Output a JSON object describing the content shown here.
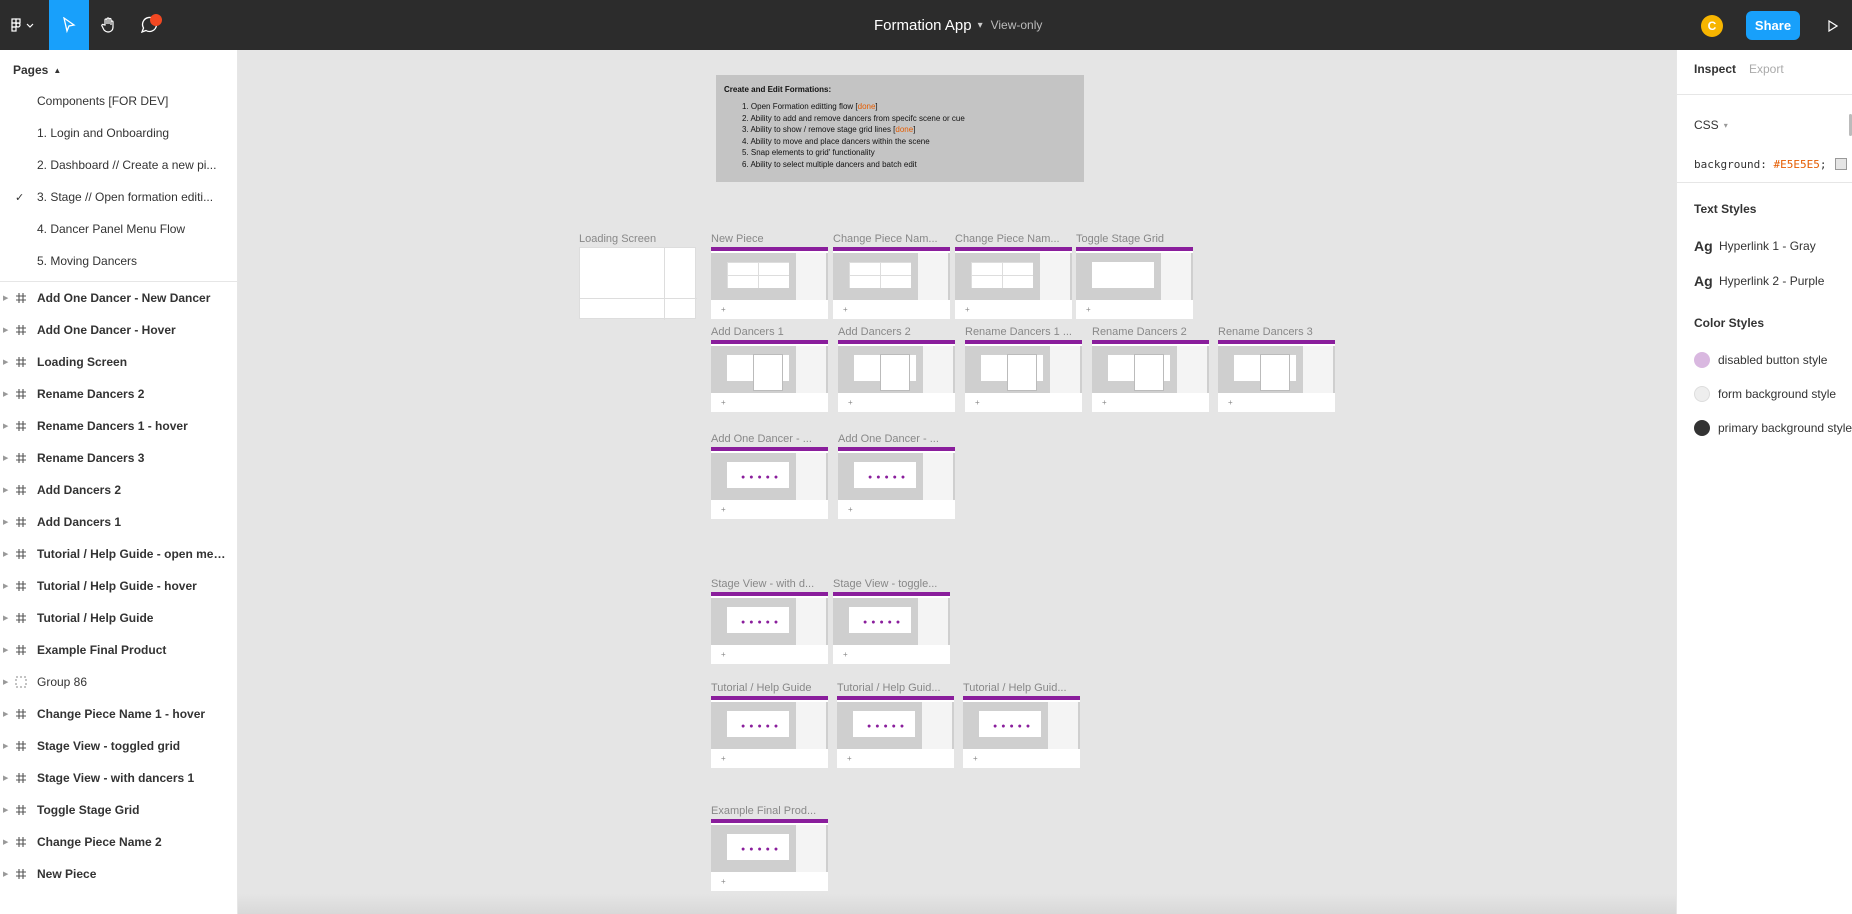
{
  "app": {
    "file_name": "Formation App",
    "view_mode": "View-only",
    "share_label": "Share",
    "avatar_initial": "C",
    "accent_color": "#18a0fb",
    "notification_color": "#f24822"
  },
  "pages": {
    "header": "Pages",
    "items": [
      {
        "label": "Components [FOR DEV]",
        "selected": false
      },
      {
        "label": "1. Login and Onboarding",
        "selected": false
      },
      {
        "label": "2. Dashboard // Create a new pi...",
        "selected": false
      },
      {
        "label": "3. Stage // Open formation editi...",
        "selected": true
      },
      {
        "label": "4. Dancer Panel Menu Flow",
        "selected": false
      },
      {
        "label": "5. Moving Dancers",
        "selected": false
      }
    ]
  },
  "layers": [
    {
      "label": "Add One Dancer - New Dancer",
      "icon": "frame-icon"
    },
    {
      "label": "Add One Dancer - Hover",
      "icon": "frame-icon"
    },
    {
      "label": "Loading Screen",
      "icon": "frame-icon"
    },
    {
      "label": "Rename Dancers 2",
      "icon": "frame-icon"
    },
    {
      "label": "Rename Dancers 1 - hover",
      "icon": "frame-icon"
    },
    {
      "label": "Rename Dancers 3",
      "icon": "frame-icon"
    },
    {
      "label": "Add Dancers 2",
      "icon": "frame-icon"
    },
    {
      "label": "Add Dancers 1",
      "icon": "frame-icon"
    },
    {
      "label": "Tutorial / Help Guide - open menu...",
      "icon": "frame-icon"
    },
    {
      "label": "Tutorial / Help Guide - hover",
      "icon": "frame-icon"
    },
    {
      "label": "Tutorial / Help Guide",
      "icon": "frame-icon"
    },
    {
      "label": "Example Final Product",
      "icon": "frame-icon"
    },
    {
      "label": "Group 86",
      "icon": "group-icon"
    },
    {
      "label": "Change Piece Name 1 - hover",
      "icon": "frame-icon"
    },
    {
      "label": "Stage View - toggled grid",
      "icon": "frame-icon"
    },
    {
      "label": "Stage View - with dancers 1",
      "icon": "frame-icon"
    },
    {
      "label": "Toggle Stage Grid",
      "icon": "frame-icon"
    },
    {
      "label": "Change Piece Name 2",
      "icon": "frame-icon"
    },
    {
      "label": "New Piece",
      "icon": "frame-icon"
    }
  ],
  "inspect": {
    "tabs": [
      "Inspect",
      "Export"
    ],
    "code_language": "CSS",
    "code_property": "background:",
    "code_value": "#E5E5E5",
    "code_end": ";",
    "text_styles_header": "Text Styles",
    "text_styles": [
      "Hyperlink 1 - Gray",
      "Hyperlink 2 - Purple"
    ],
    "color_styles_header": "Color Styles",
    "color_styles": [
      {
        "label": "disabled button style",
        "color": "#d9b8e0"
      },
      {
        "label": "form background style",
        "color": "#eeeeee"
      },
      {
        "label": "primary background style",
        "color": "#333333"
      }
    ]
  },
  "canvas": {
    "background": "#E5E5E5",
    "note": {
      "title": "Create and Edit Formations:",
      "items": [
        {
          "text": "1. Open Formation editting flow [",
          "done": "done",
          "end": "]"
        },
        {
          "text": "2. Ability to add and remove dancers from specifc scene or cue",
          "done": "",
          "end": ""
        },
        {
          "text": "3. Ability to show / remove stage grid lines [",
          "done": "done",
          "end": "]"
        },
        {
          "text": "4. Ability to move and place dancers within the scene",
          "done": "",
          "end": ""
        },
        {
          "text": "5. Snap elements to grid' functionality",
          "done": "",
          "end": ""
        },
        {
          "text": "6. Ability to select multiple dancers and batch edit",
          "done": "",
          "end": ""
        }
      ]
    },
    "frames": [
      {
        "label": "Loading Screen",
        "variant": "loading"
      },
      {
        "label": "New Piece",
        "variant": "grid"
      },
      {
        "label": "Change Piece Nam...",
        "variant": "grid"
      },
      {
        "label": "Change Piece Nam...",
        "variant": "grid"
      },
      {
        "label": "Toggle Stage Grid",
        "variant": "plain"
      },
      {
        "label": "Add Dancers 1",
        "variant": "modal"
      },
      {
        "label": "Add Dancers 2",
        "variant": "modal"
      },
      {
        "label": "Rename Dancers 1 ...",
        "variant": "modal"
      },
      {
        "label": "Rename Dancers 2",
        "variant": "modal"
      },
      {
        "label": "Rename Dancers 3",
        "variant": "modal"
      },
      {
        "label": "Add One Dancer - ...",
        "variant": "dancers"
      },
      {
        "label": "Add One Dancer - ...",
        "variant": "dancers"
      },
      {
        "label": "Stage View - with d...",
        "variant": "dancers"
      },
      {
        "label": "Stage View - toggle...",
        "variant": "dancers"
      },
      {
        "label": "Tutorial / Help Guide",
        "variant": "dancers"
      },
      {
        "label": "Tutorial / Help Guid...",
        "variant": "dancers"
      },
      {
        "label": "Tutorial / Help Guid...",
        "variant": "dancers"
      },
      {
        "label": "Example Final Prod...",
        "variant": "dancers"
      }
    ]
  }
}
